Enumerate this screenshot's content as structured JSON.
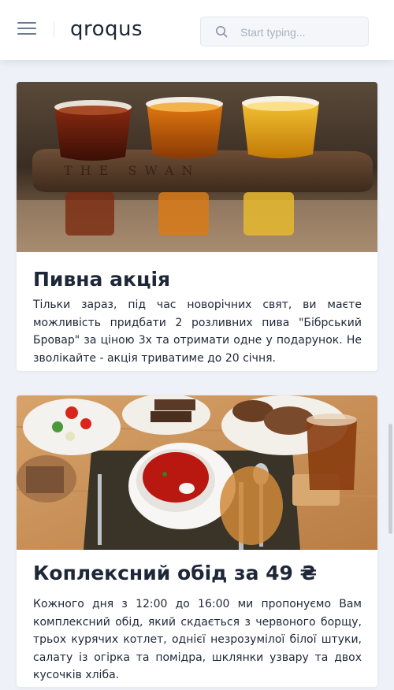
{
  "header": {
    "logo": "qroqus",
    "search": {
      "placeholder": "Start typing...",
      "value": ""
    }
  },
  "posts": [
    {
      "title": "Пивна акція",
      "text": "Тільки зараз, під час новорічних свят, ви маєте можливість придбати 2 розливних пива \"Бібрський Бровар\" за ціною 3х та отримати одне у подарунок. Не зволікайте - акція триватиме до 20 січня.",
      "image": "beer-flight-photo",
      "image_text": "THE SWAN"
    },
    {
      "title": "Коплексний обід за 49 ₴",
      "text": "Кожного дня з 12:00 до 16:00 ми пропонуємо Вам комплексний обід, який скдається з червоного борщу, трьох курячих котлет, однієї незрозумілої білої штуки, салату із огірка та помідра, шклянки узвару та двох кусочків хліба.",
      "image": "lunch-table-photo"
    }
  ],
  "colors": {
    "accent": "#1e2737",
    "background": "#eef1f7"
  }
}
